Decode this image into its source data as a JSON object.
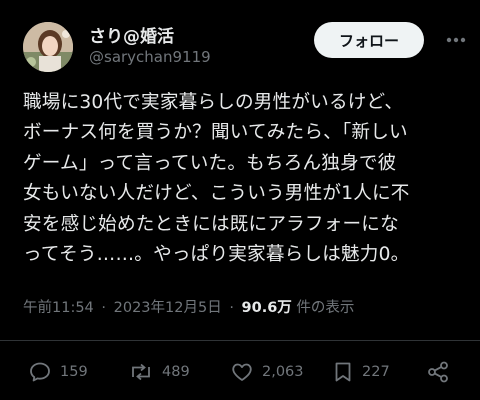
{
  "author": {
    "display_name": "さり@婚活",
    "handle": "@sarychan9119"
  },
  "follow_label": "フォロー",
  "post": {
    "lines": [
      "職場に30代で実家暮らしの男性がいるけど、",
      "ボーナス何を買うか？聞いてみたら、「新しい",
      "ゲーム」って言っていた。もちろん独身で彼",
      "女もいない人だけど、こういう男性が1人に不",
      "安を感じ始めたときには既にアラフォーにな",
      "ってそう……。やっぱり実家暮らしは魅力0。"
    ]
  },
  "meta": {
    "time": "午前11:54",
    "separator": "·",
    "date": "2023年12月5日",
    "views_count": "90.6万",
    "views_label": "件の表示"
  },
  "stats": {
    "replies": "159",
    "reposts": "489",
    "likes": "2,063",
    "bookmarks": "227"
  },
  "icons": {
    "reply": "reply-icon",
    "repost": "repost-icon",
    "like": "heart-icon",
    "bookmark": "bookmark-icon",
    "share": "share-icon",
    "more": "more-icon"
  },
  "colors": {
    "background": "#000000",
    "text": "#e7e9ea",
    "muted": "#71767b",
    "follow_bg": "#eff3f4"
  }
}
